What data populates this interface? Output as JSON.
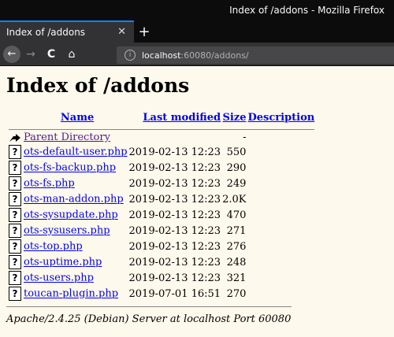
{
  "window": {
    "title": "Index of /addons - Mozilla Firefox"
  },
  "tab": {
    "label": "Index of /addons",
    "close": "✕",
    "new_tab": "+"
  },
  "nav": {
    "back": "←",
    "forward": "→",
    "reload": "C",
    "home": "⌂"
  },
  "url": {
    "host": "localhost",
    "rest": ":60080/addons/"
  },
  "page": {
    "heading": "Index of /addons",
    "columns": {
      "name": "Name",
      "modified": "Last modified",
      "size": "Size",
      "description": "Description"
    },
    "parent": {
      "label": "Parent Directory",
      "size": "-"
    },
    "rows": [
      {
        "name": "ots-default-user.php",
        "modified": "2019-02-13 12:23",
        "size": "550"
      },
      {
        "name": "ots-fs-backup.php",
        "modified": "2019-02-13 12:23",
        "size": "290"
      },
      {
        "name": "ots-fs.php",
        "modified": "2019-02-13 12:23",
        "size": "249"
      },
      {
        "name": "ots-man-addon.php",
        "modified": "2019-02-13 12:23",
        "size": "2.0K"
      },
      {
        "name": "ots-sysupdate.php",
        "modified": "2019-02-13 12:23",
        "size": "470"
      },
      {
        "name": "ots-sysusers.php",
        "modified": "2019-02-13 12:23",
        "size": "271"
      },
      {
        "name": "ots-top.php",
        "modified": "2019-02-13 12:23",
        "size": "276"
      },
      {
        "name": "ots-uptime.php",
        "modified": "2019-02-13 12:23",
        "size": "248"
      },
      {
        "name": "ots-users.php",
        "modified": "2019-02-13 12:23",
        "size": "321"
      },
      {
        "name": "toucan-plugin.php",
        "modified": "2019-07-01 16:51",
        "size": "270"
      }
    ],
    "footer": "Apache/2.4.25 (Debian) Server at localhost Port 60080"
  }
}
